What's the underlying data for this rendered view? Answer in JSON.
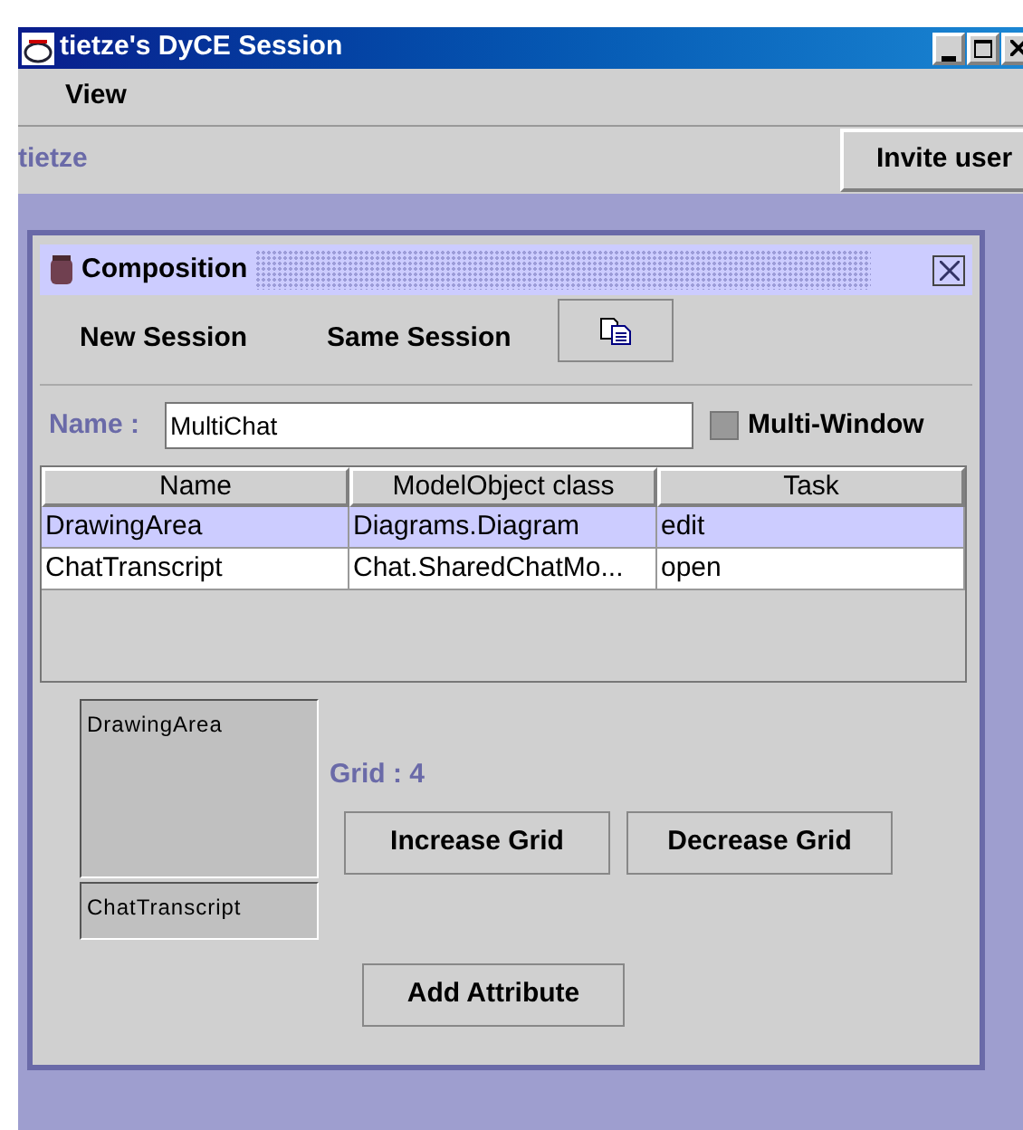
{
  "window": {
    "title": "tietze's DyCE Session"
  },
  "menu": [
    "View"
  ],
  "toolbar": {
    "user": "tietze",
    "invite_button": "Invite user"
  },
  "composition": {
    "title": "Composition",
    "session_options": [
      "New Session",
      "Same Session"
    ],
    "name_label": "Name :",
    "name_value": "MultiChat",
    "multi_window": {
      "label": "Multi-Window",
      "checked": false
    },
    "table": {
      "columns": [
        "Name",
        "ModelObject class",
        "Task"
      ],
      "rows": [
        {
          "cells": [
            "DrawingArea",
            "Diagrams.Diagram",
            "edit"
          ],
          "selected": true
        },
        {
          "cells": [
            "ChatTranscript",
            "Chat.SharedChatMo...",
            "open"
          ],
          "selected": false
        }
      ]
    },
    "preview_panes": [
      "DrawingArea",
      "ChatTranscript"
    ],
    "grid_label": "Grid : 4",
    "grid_buttons": [
      "Increase Grid",
      "Decrease Grid"
    ],
    "add_button": "Add Attribute"
  }
}
